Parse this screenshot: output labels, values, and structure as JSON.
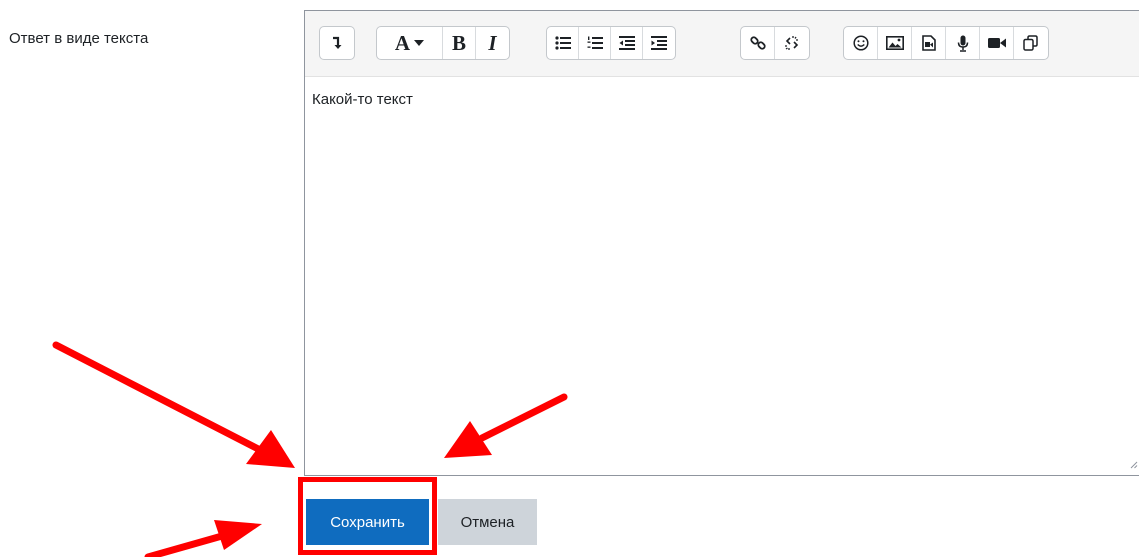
{
  "field": {
    "label": "Ответ в виде текста"
  },
  "editor": {
    "content_text": "Какой-то текст",
    "toolbar": [
      [
        "expand-toolbar-icon"
      ],
      [
        "font-style-dropdown-icon",
        "bold-icon",
        "italic-icon"
      ],
      [
        "unordered-list-icon",
        "ordered-list-icon",
        "outdent-icon",
        "indent-icon"
      ],
      [
        "link-icon",
        "unlink-icon"
      ],
      [
        "emoji-icon",
        "image-icon",
        "media-icon",
        "record-audio-icon",
        "record-video-icon",
        "manage-files-icon"
      ]
    ],
    "glyphs": {
      "font": "A",
      "bold": "B",
      "italic": "I"
    }
  },
  "buttons": {
    "save_label": "Сохранить",
    "cancel_label": "Отмена"
  },
  "annotation": {
    "color": "#ff0000",
    "arrows": 3,
    "highlighted": "save-button"
  },
  "colors": {
    "primary": "#0f6cbf",
    "secondary": "#ced4da",
    "text": "#1d2125"
  }
}
